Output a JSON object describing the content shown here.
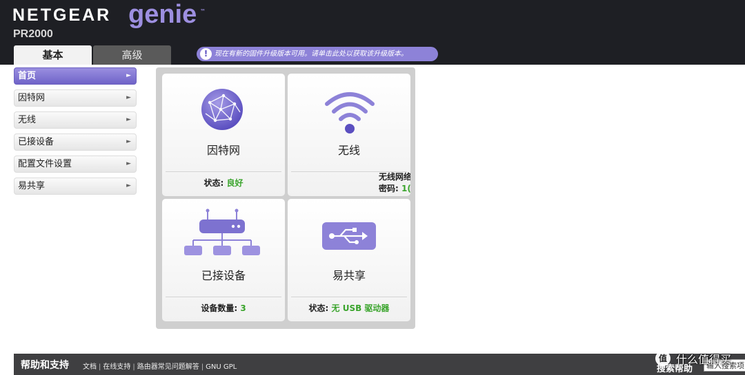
{
  "header": {
    "brand": "NETGEAR",
    "product": "genie",
    "trademark": "™",
    "model": "PR2000"
  },
  "tabs": [
    {
      "label": "基本",
      "active": true
    },
    {
      "label": "高级",
      "active": false
    }
  ],
  "notice": {
    "icon": "!",
    "text": "现在有新的固件升级版本可用。请单击此处以获取该升级版本。"
  },
  "sidebar": {
    "items": [
      {
        "label": "首页",
        "active": true
      },
      {
        "label": "因特网",
        "active": false
      },
      {
        "label": "无线",
        "active": false
      },
      {
        "label": "已接设备",
        "active": false
      },
      {
        "label": "配置文件设置",
        "active": false
      },
      {
        "label": "易共享",
        "active": false
      }
    ],
    "arrow": "►"
  },
  "tiles": {
    "internet": {
      "title": "因特网",
      "status_label": "状态:",
      "status_value": "良好"
    },
    "wireless": {
      "title": "无线",
      "line1": "无线网络",
      "line2_label": "密码:",
      "line2_value": "1("
    },
    "devices": {
      "title": "已接设备",
      "status_label": "设备数量:",
      "status_value": "3"
    },
    "share": {
      "title": "易共享",
      "status_label": "状态:",
      "status_value": "无  USB 驱动器"
    }
  },
  "footer": {
    "title": "帮助和支持",
    "links": [
      "文档",
      "在线支持",
      "路由器常见问题解答",
      "GNU GPL"
    ],
    "search_label": "搜索帮助",
    "search_value": "输入搜索项"
  },
  "watermark": {
    "icon": "值",
    "text": "什么值得买"
  },
  "colors": {
    "accent": "#8d82d8",
    "header_bg": "#1e1f24",
    "status_green": "#3aa42c",
    "footer_bg": "#3f3f41"
  }
}
